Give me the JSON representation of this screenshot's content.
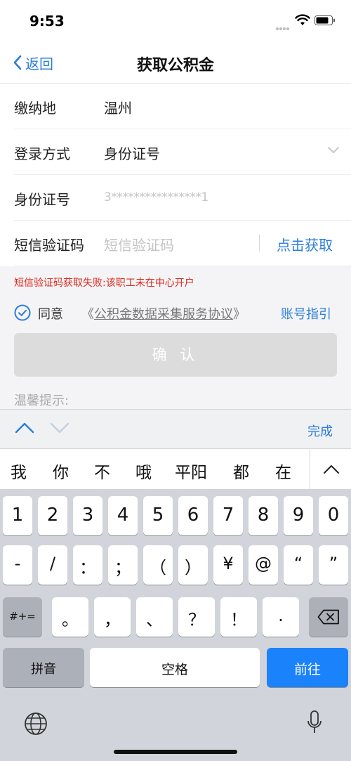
{
  "status": {
    "time": "9:53"
  },
  "nav": {
    "back_label": "返回",
    "title": "获取公积金"
  },
  "form": {
    "pay_location": {
      "label": "缴纳地",
      "value": "温州"
    },
    "login_method": {
      "label": "登录方式",
      "value": "身份证号"
    },
    "id_number": {
      "label": "身份证号",
      "value": "3****************1"
    },
    "sms_code": {
      "label": "短信验证码",
      "placeholder": "短信验证码",
      "get_code_label": "点击获取"
    }
  },
  "error_message": "短信验证码获取失败:该职工未在中心开户",
  "agreement": {
    "prefix": "同意",
    "open_quote": "《",
    "link_text": "公积金数据采集服务协议",
    "close_quote": "》",
    "checked": true,
    "guide_label": "账号指引"
  },
  "confirm_label": "确 认",
  "tips_label": "温馨提示:",
  "accessory": {
    "done_label": "完成"
  },
  "candidates": [
    "我",
    "你",
    "不",
    "哦",
    "平阳",
    "都",
    "在"
  ],
  "keyboard": {
    "row1": [
      "1",
      "2",
      "3",
      "4",
      "5",
      "6",
      "7",
      "8",
      "9",
      "0"
    ],
    "row2": [
      "-",
      "/",
      "：",
      "；",
      "（",
      "）",
      "¥",
      "@",
      "“",
      "”"
    ],
    "row3": [
      "。",
      "，",
      "、",
      "？",
      "！",
      "."
    ],
    "symbols_label": "#+=",
    "pinyin_label": "拼音",
    "space_label": "空格",
    "go_label": "前往"
  },
  "colors": {
    "accent": "#2a7ed8",
    "error": "#e0281e",
    "go_button": "#1a82fb"
  }
}
